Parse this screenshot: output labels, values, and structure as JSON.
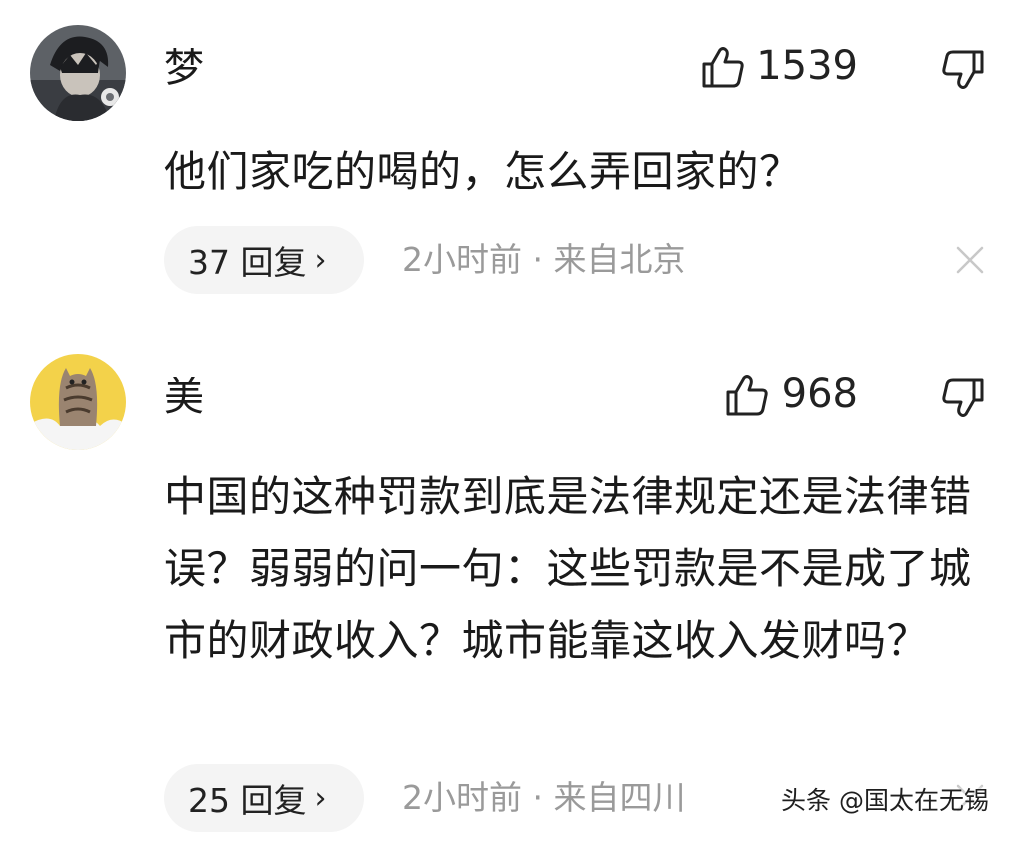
{
  "comments": [
    {
      "avatar": "anime-character-avatar",
      "username": "梦",
      "likes": "1539",
      "text": "他们家吃的喝的，怎么弄回家的？",
      "replies_label": "37 回复",
      "chevron": "›",
      "meta": "2小时前 · 来自北京",
      "icons": {
        "like": "thumbs-up-icon",
        "dislike": "thumbs-down-icon",
        "close": "close-icon"
      }
    },
    {
      "avatar": "cat-avatar",
      "username": "美",
      "likes": "968",
      "text": "中国的这种罚款到底是法律规定还是法律错误？弱弱的问一句：这些罚款是不是成了城市的财政收入？城市能靠这收入发财吗？",
      "replies_label": "25 回复",
      "chevron": "›",
      "meta": "2小时前 · 来自四川",
      "icons": {
        "like": "thumbs-up-icon",
        "dislike": "thumbs-down-icon",
        "close": "close-icon"
      }
    }
  ],
  "watermark": "头条 @国太在无锡",
  "colors": {
    "text": "#1a1a1a",
    "meta": "#9a9a9a",
    "pill_bg": "#f4f4f4",
    "icon_stroke": "#222222",
    "close_stroke": "#c8c8c8"
  }
}
